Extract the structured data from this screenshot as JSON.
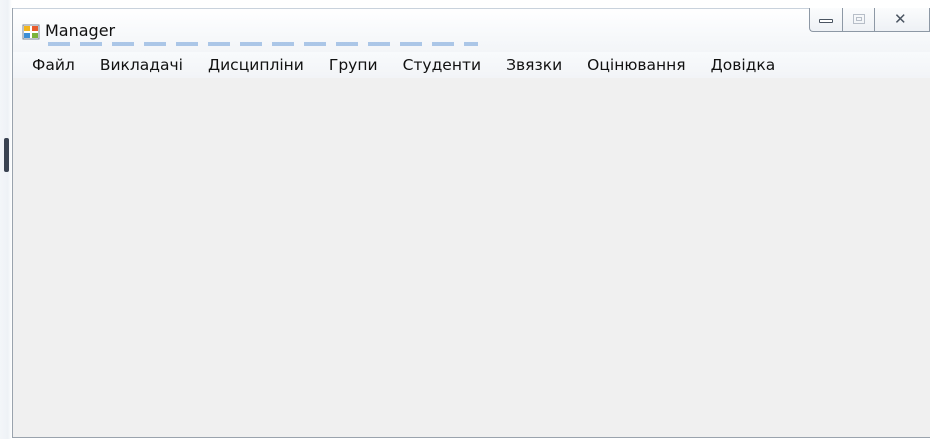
{
  "window": {
    "title": "Manager",
    "controls": {
      "minimize_icon": "minimize-icon",
      "maximize_icon": "maximize-icon",
      "close_glyph": "✕"
    }
  },
  "menubar": {
    "items": [
      {
        "label": "Файл"
      },
      {
        "label": "Викладачі"
      },
      {
        "label": "Дисципліни"
      },
      {
        "label": "Групи"
      },
      {
        "label": "Студенти"
      },
      {
        "label": "Звязки"
      },
      {
        "label": "Оцінювання"
      },
      {
        "label": "Довідка"
      }
    ]
  },
  "colors": {
    "client_background": "#f0f0f0",
    "window_border": "#9aa3ad",
    "text": "#111111"
  }
}
